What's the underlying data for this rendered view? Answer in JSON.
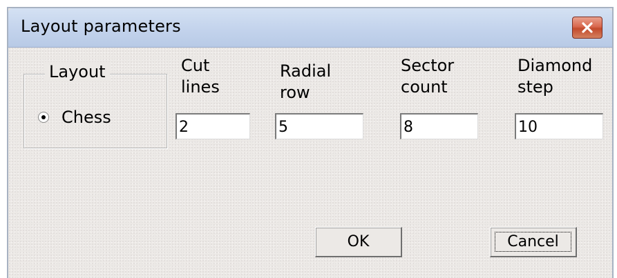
{
  "window": {
    "title": "Layout parameters",
    "close_icon": "close-icon",
    "colors": {
      "titlebar": "#c3d3ec",
      "close_button": "#d9694f",
      "dialog_background": "#ece9e6"
    }
  },
  "layout_group": {
    "legend": "Layout",
    "options": [
      {
        "label": "Chess",
        "selected": true
      }
    ]
  },
  "params": [
    {
      "label_line1": "Cut",
      "label_line2": "lines",
      "value": "2"
    },
    {
      "label_line1": "Radial",
      "label_line2": "row",
      "value": "5"
    },
    {
      "label_line1": "Sector",
      "label_line2": "count",
      "value": "8"
    },
    {
      "label_line1": "Diamond",
      "label_line2": "step",
      "value": "10"
    }
  ],
  "buttons": {
    "ok": "OK",
    "cancel": "Cancel"
  }
}
